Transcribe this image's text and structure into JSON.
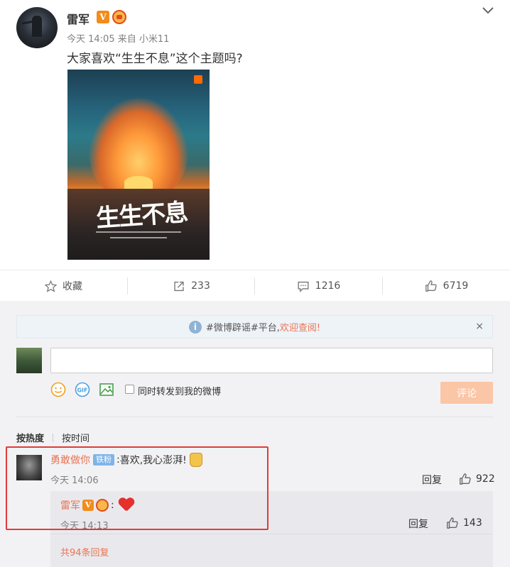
{
  "post": {
    "author": "雷军",
    "verified_badge": "V",
    "time": "今天 14:05",
    "source_prefix": "来自",
    "source": "小米11",
    "text": "大家喜欢“生生不息”这个主题吗?",
    "image": {
      "title": "生生不息",
      "colors": {
        "sky": "#26627a",
        "sunset": "#e08a34"
      }
    }
  },
  "actions": {
    "favorite_label": "收藏",
    "repost_count": "233",
    "comment_count": "1216",
    "like_count": "6719"
  },
  "notice": {
    "prefix": "#微博辟谣#平台,",
    "link": "欢迎查阅!",
    "close": "×"
  },
  "composer": {
    "repost_checkbox_label": "同时转发到我的微博",
    "submit_label": "评论",
    "tools": [
      "smile-icon",
      "gif-icon",
      "image-icon"
    ]
  },
  "sort": {
    "by_hot": "按热度",
    "by_time": "按时间"
  },
  "comment": {
    "username": "勇敢做你",
    "fan_badge": "铁粉",
    "separator": ":",
    "text": "喜欢,我心澎湃!",
    "time": "今天 14:06",
    "reply_label": "回复",
    "likes": "922"
  },
  "reply": {
    "username": "雷军",
    "verified_badge": "V",
    "separator": ":",
    "time": "今天 14:13",
    "reply_label": "回复",
    "likes": "143",
    "more_replies": "共94条回复"
  },
  "colors": {
    "accent": "#eb7350",
    "highlight_border": "#e53a3a",
    "submit_disabled": "#fbc6a6"
  }
}
